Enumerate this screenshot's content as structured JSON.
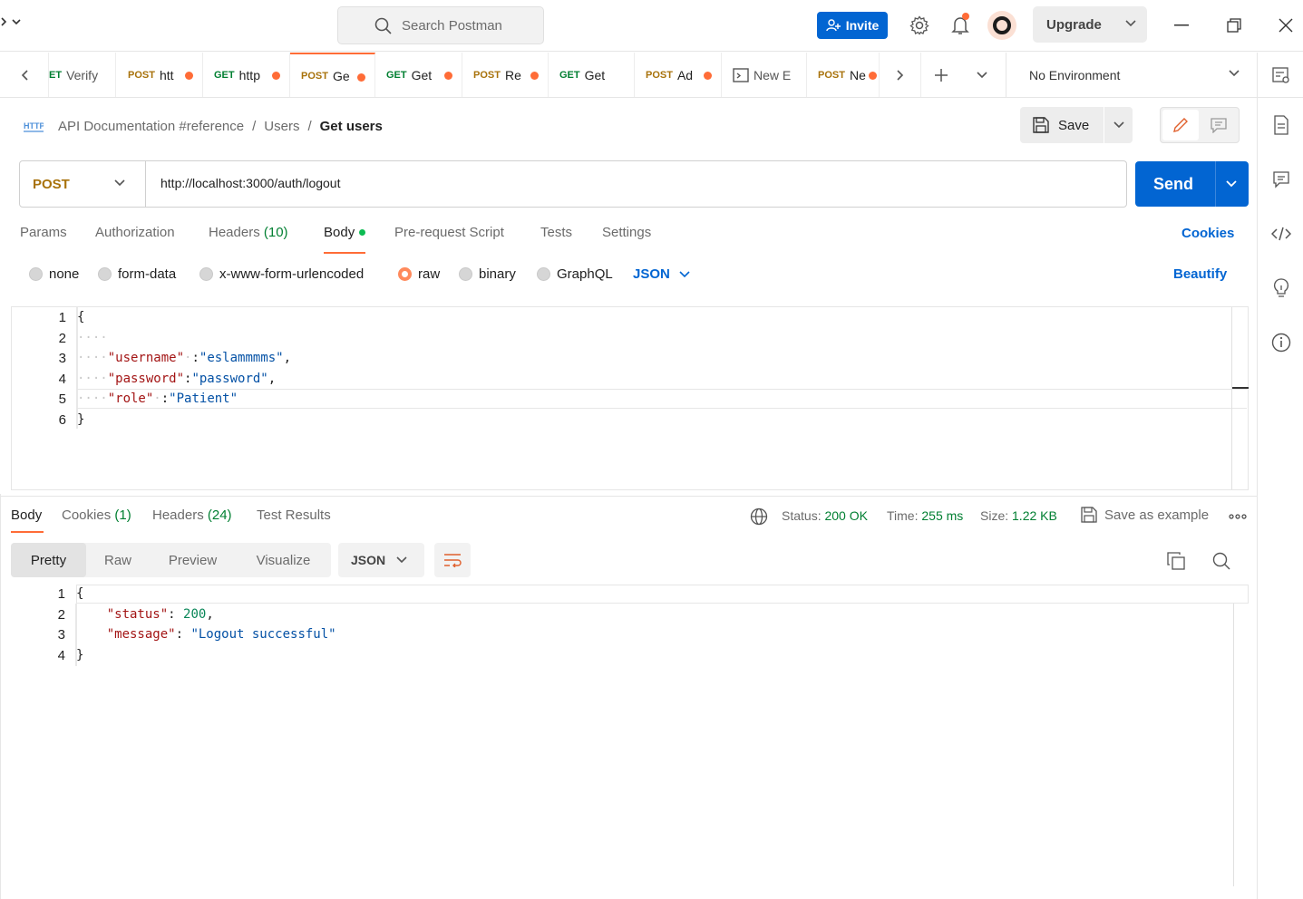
{
  "titlebar": {
    "back_label": "‹",
    "search_placeholder": "Search Postman",
    "invite_label": "Invite",
    "upgrade_label": "Upgrade"
  },
  "tabs": [
    {
      "method": "ET",
      "name": "Verify",
      "dot": false
    },
    {
      "method": "POST",
      "name": "htt",
      "dot": true
    },
    {
      "method": "GET",
      "name": "http",
      "dot": true
    },
    {
      "method": "POST",
      "name": "Ge",
      "dot": true,
      "active": true
    },
    {
      "method": "GET",
      "name": "Get",
      "dot": true
    },
    {
      "method": "POST",
      "name": "Re",
      "dot": true
    },
    {
      "method": "GET",
      "name": "Get",
      "dot": false
    },
    {
      "method": "POST",
      "name": "Ad",
      "dot": true
    },
    {
      "method": "",
      "name": "New E",
      "dot": false
    },
    {
      "method": "POST",
      "name": "Ne",
      "dot": true
    }
  ],
  "environment": "No Environment",
  "breadcrumb": {
    "collection": "API Documentation #reference",
    "folder": "Users",
    "current": "Get users"
  },
  "save_label": "Save",
  "request": {
    "method": "POST",
    "url": "http://localhost:3000/auth/logout",
    "send_label": "Send"
  },
  "request_tabs": {
    "params": "Params",
    "authorization": "Authorization",
    "headers": "Headers",
    "headers_count": "(10)",
    "body": "Body",
    "prerequest": "Pre-request Script",
    "tests": "Tests",
    "settings": "Settings",
    "cookies": "Cookies"
  },
  "body_types": {
    "none": "none",
    "form_data": "form-data",
    "urlencoded": "x-www-form-urlencoded",
    "raw": "raw",
    "binary": "binary",
    "graphql": "GraphQL",
    "format": "JSON",
    "beautify": "Beautify"
  },
  "request_body": {
    "line_numbers": [
      "1",
      "2",
      "3",
      "4",
      "5",
      "6"
    ],
    "open_brace": "{",
    "close_brace": "}",
    "username_key": "\"username\"",
    "username_val": "\"eslammmms\"",
    "password_key": "\"password\"",
    "password_val": "\"password\"",
    "role_key": "\"role\"",
    "role_val": "\"Patient\""
  },
  "response_tabs": {
    "body": "Body",
    "cookies": "Cookies",
    "cookies_count": "(1)",
    "headers": "Headers",
    "headers_count": "(24)",
    "test_results": "Test Results"
  },
  "response_status": {
    "status_label": "Status:",
    "status_value": "200 OK",
    "time_label": "Time:",
    "time_value": "255 ms",
    "size_label": "Size:",
    "size_value": "1.22 KB",
    "save_example": "Save as example"
  },
  "response_view": {
    "pretty": "Pretty",
    "raw": "Raw",
    "preview": "Preview",
    "visualize": "Visualize",
    "format": "JSON"
  },
  "response_body": {
    "line_numbers": [
      "1",
      "2",
      "3",
      "4"
    ],
    "open_brace": "{",
    "close_brace": "}",
    "status_key": "\"status\"",
    "status_val": "200",
    "message_key": "\"message\"",
    "message_val": "\"Logout successful\""
  },
  "colors": {
    "accent": "#ff6c37",
    "primary": "#0265d2",
    "post": "#a8720b",
    "get": "#007f31"
  }
}
